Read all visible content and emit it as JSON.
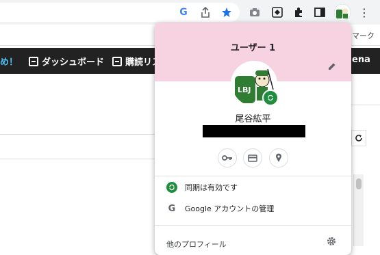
{
  "toolbar": {
    "icons": [
      "google-icon",
      "share-icon",
      "star-icon",
      "camera-icon",
      "extension-box-icon",
      "puzzle-icon",
      "sidepanel-icon",
      "profile-avatar-icon",
      "more-icon"
    ],
    "google_letter": "G",
    "more_glyph": "⋮",
    "star_color": "#1a73e8"
  },
  "bookmarks": {
    "right_text": "マーク"
  },
  "sitebar": {
    "left_text": "め！",
    "dashboard": "ダッシュボード",
    "subscription": "購読リス",
    "right_text": "ena",
    "left_text_color": "#4fc3f7"
  },
  "popup": {
    "title": "ユーザー 1",
    "header_color": "#f7d2e0",
    "user_name": "尾谷紘平",
    "quick_buttons": [
      "key-icon",
      "payment-card-icon",
      "location-pin-icon"
    ],
    "sync_text": "同期は有効です",
    "sync_color": "#1e8e3e",
    "google_letter": "G",
    "manage_account": "Google アカウントの管理",
    "other_profiles": "他のプロフィール"
  }
}
